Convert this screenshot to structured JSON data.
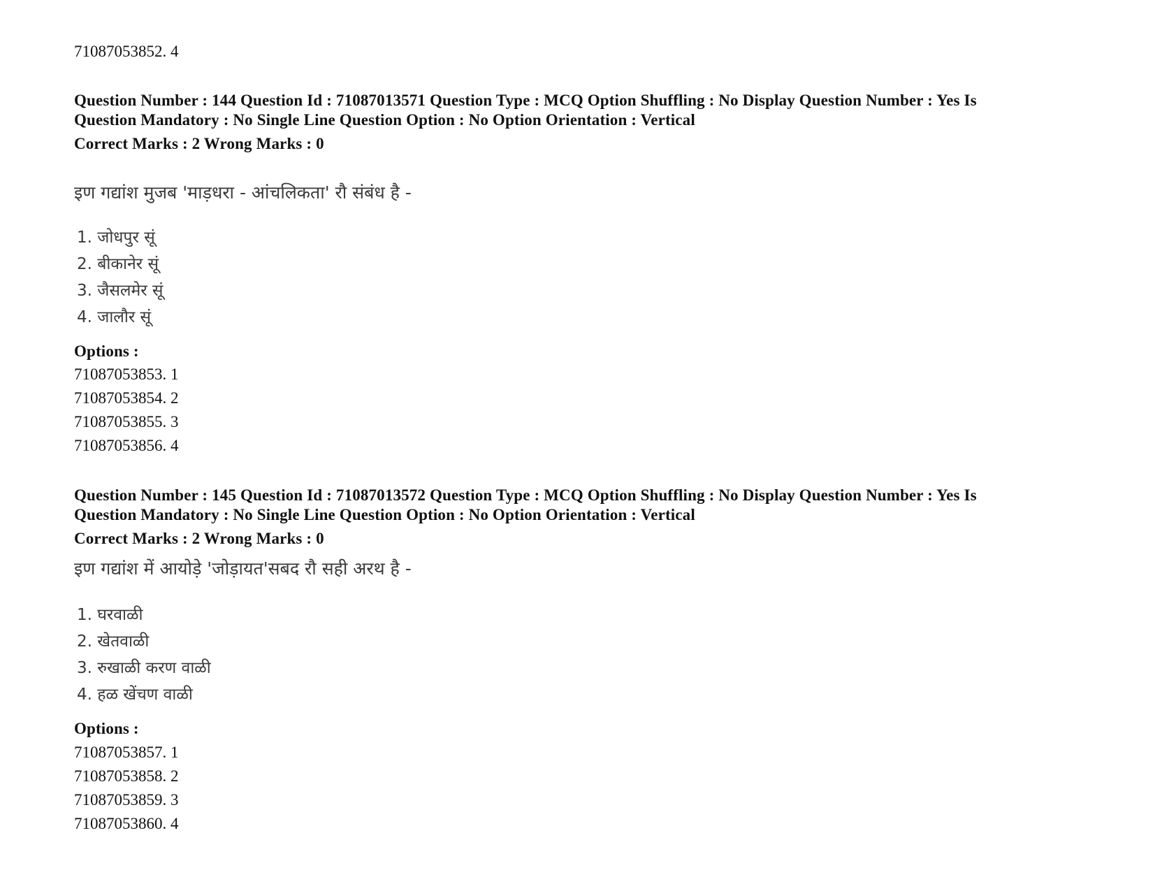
{
  "prev_question": {
    "last_option": "71087053852. 4"
  },
  "questions": [
    {
      "meta_line1": "Question Number : 144 Question Id : 71087013571 Question Type : MCQ Option Shuffling : No Display Question Number : Yes Is",
      "meta_line2": "Question Mandatory : No Single Line Question Option : No Option Orientation : Vertical",
      "marks": "Correct Marks : 2 Wrong Marks : 0",
      "text": "इण गद्यांश मुजब 'माड़धरा - आंचलिकता' रौ संबंध है -",
      "choices": [
        "1. जोधपुर सूं",
        "2. बीकानेर सूं",
        "3. जैसलमेर सूं",
        "4. जालौर सूं"
      ],
      "options_label": "Options :",
      "options": [
        "71087053853. 1",
        "71087053854. 2",
        "71087053855. 3",
        "71087053856. 4"
      ]
    },
    {
      "meta_line1": "Question Number : 145 Question Id : 71087013572 Question Type : MCQ Option Shuffling : No Display Question Number : Yes Is",
      "meta_line2": "Question Mandatory : No Single Line Question Option : No Option Orientation : Vertical",
      "marks": "Correct Marks : 2 Wrong Marks : 0",
      "text": "इण गद्यांश में आयोड़े 'जोड़ायत'सबद रौ सही अरथ है -",
      "choices": [
        "1. घरवाळी",
        "2. खेतवाळी",
        "3. रुखाळी करण वाळी",
        "4. हळ खेंचण वाळी"
      ],
      "options_label": "Options :",
      "options": [
        "71087053857. 1",
        "71087053858. 2",
        "71087053859. 3",
        "71087053860. 4"
      ]
    }
  ]
}
